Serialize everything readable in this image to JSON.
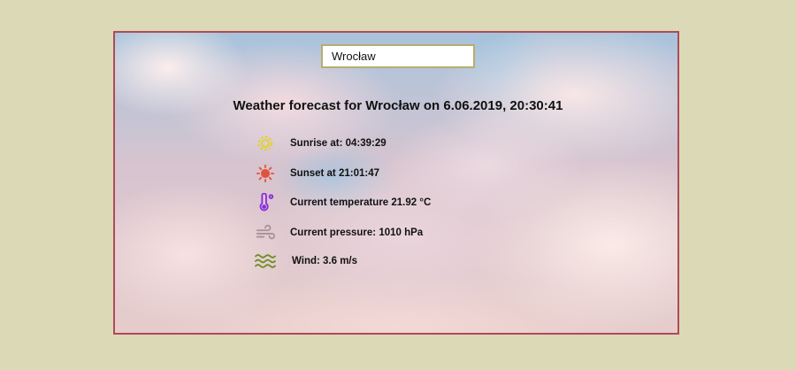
{
  "search": {
    "value": "Wrocław",
    "placeholder": ""
  },
  "forecast": {
    "title": "Weather forecast for Wrocław on 6.06.2019, 20:30:41",
    "items": [
      {
        "icon": "sunrise-icon",
        "label": "Sunrise at: 04:39:29",
        "color": "#e3d21a"
      },
      {
        "icon": "sunset-icon",
        "label": "Sunset at 21:01:47",
        "color": "#e0533c"
      },
      {
        "icon": "thermometer-icon",
        "label": "Current temperature 21.92 °C",
        "color": "#8a2be2"
      },
      {
        "icon": "pressure-wind-icon",
        "label": "Current pressure: 1010 hPa",
        "color": "#a89098"
      },
      {
        "icon": "wind-waves-icon",
        "label": "Wind: 3.6 m/s",
        "color": "#6b8e23"
      }
    ]
  }
}
